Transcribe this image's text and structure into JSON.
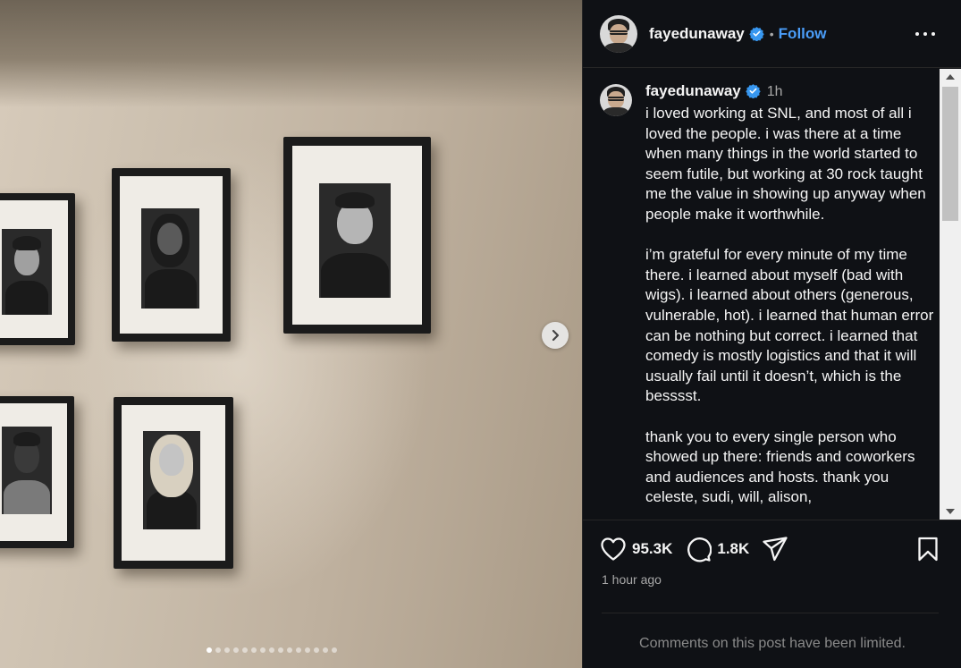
{
  "post": {
    "username": "fayedunaway",
    "follow_label": "Follow",
    "separator": "•",
    "time_short": "1h",
    "caption_paragraphs": [
      "i loved working at SNL, and most of all i loved the people. i was there at a time when many things in the world started to seem futile, but working at 30 rock taught me the value in showing up anyway when people make it worthwhile.",
      "i’m grateful for every minute of my time there. i learned about myself (bad with wigs). i learned about others (generous, vulnerable, hot). i learned that human error can be nothing but correct. i learned that comedy is mostly logistics and that it will usually fail until it doesn’t, which is the besssst.",
      "thank you to every single person who showed up there: friends and coworkers and audiences and hosts. thank you celeste, sudi, will, alison,"
    ],
    "likes": "95.3K",
    "comments": "1.8K",
    "posted_time": "1 hour ago",
    "comments_notice": "Comments on this post have been limited."
  },
  "carousel": {
    "slide_count": 15,
    "active_index": 0
  },
  "icons": {
    "verified": "verified-badge-icon",
    "more": "more-options-icon",
    "like": "heart-icon",
    "comment": "comment-icon",
    "share": "send-icon",
    "save": "bookmark-icon",
    "next": "chevron-right-icon"
  },
  "colors": {
    "accent": "#4a9df8",
    "panel_bg": "#0f1115",
    "verified": "#3797f0"
  }
}
